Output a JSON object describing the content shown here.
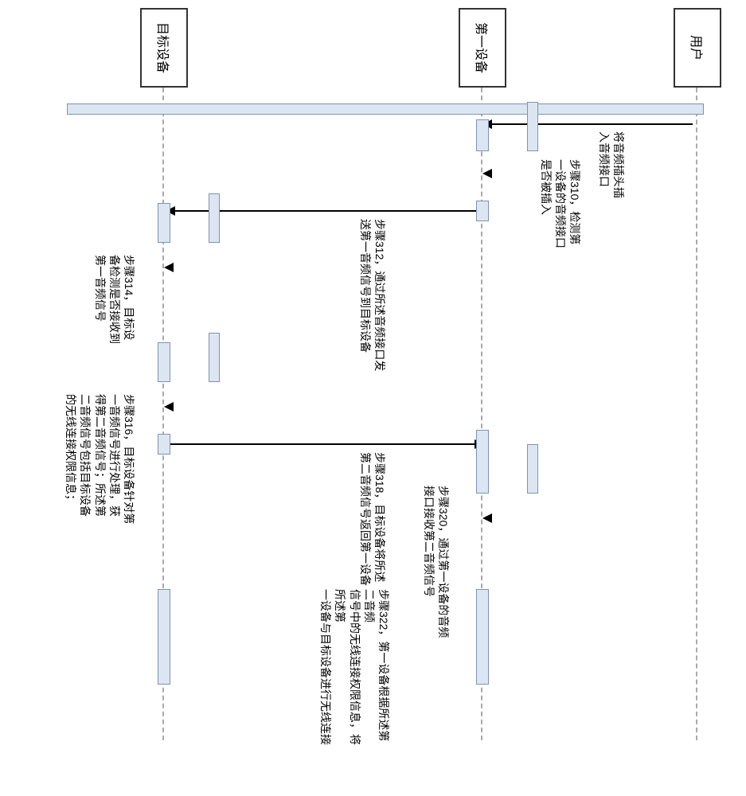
{
  "lanes": {
    "user": "用户",
    "device1": "第一设备",
    "target": "目标设备"
  },
  "labels": {
    "insert_plug": "将音频插头插\n入音频接口",
    "step310": "步骤310，检测第\n一设备的音频接口\n是否被插入",
    "step312": "步骤312，通过所述音频接口发\n送第一音频信号到目标设备",
    "step314": "步骤314，目标设\n备检测是否接收到\n第一音频信号",
    "step316": "步骤316，目标设备针对第\n一音频信号进行处理，获\n得第二音频信号；所述第\n二音频信号包括目标设备\n的无线连接权限信息；",
    "step318": "步骤318，目标设备将所述\n第二音频信号返回第一设备",
    "step320": "步骤320，通过第一设备的音频\n接口接收第二音频信号",
    "step322": "步骤322，第一设备根据所述第二音频\n信号中的无线连接权限信息，将所述第\n一设备与目标设备进行无线连接"
  },
  "chart_data": {
    "type": "table",
    "description": "Sequence diagram: wireless connection setup between first device and target device via audio interface",
    "participants": [
      "用户",
      "第一设备",
      "目标设备"
    ],
    "messages": [
      {
        "from": "用户",
        "to": "第一设备",
        "text": "将音频插头插入音频接口"
      },
      {
        "at": "第一设备",
        "text": "步骤310，检测第一设备的音频接口是否被插入"
      },
      {
        "from": "第一设备",
        "to": "目标设备",
        "text": "步骤312，通过所述音频接口发送第一音频信号到目标设备"
      },
      {
        "at": "目标设备",
        "text": "步骤314，目标设备检测是否接收到第一音频信号"
      },
      {
        "at": "目标设备",
        "text": "步骤316，目标设备针对第一音频信号进行处理，获得第二音频信号；所述第二音频信号包括目标设备的无线连接权限信息；"
      },
      {
        "from": "目标设备",
        "to": "第一设备",
        "text": "步骤318，目标设备将所述第二音频信号返回第一设备"
      },
      {
        "at": "第一设备",
        "text": "步骤320，通过第一设备的音频接口接收第二音频信号"
      },
      {
        "at": "第一设备",
        "to": "目标设备",
        "text": "步骤322，第一设备根据所述第二音频信号中的无线连接权限信息，将所述第一设备与目标设备进行无线连接"
      }
    ]
  }
}
